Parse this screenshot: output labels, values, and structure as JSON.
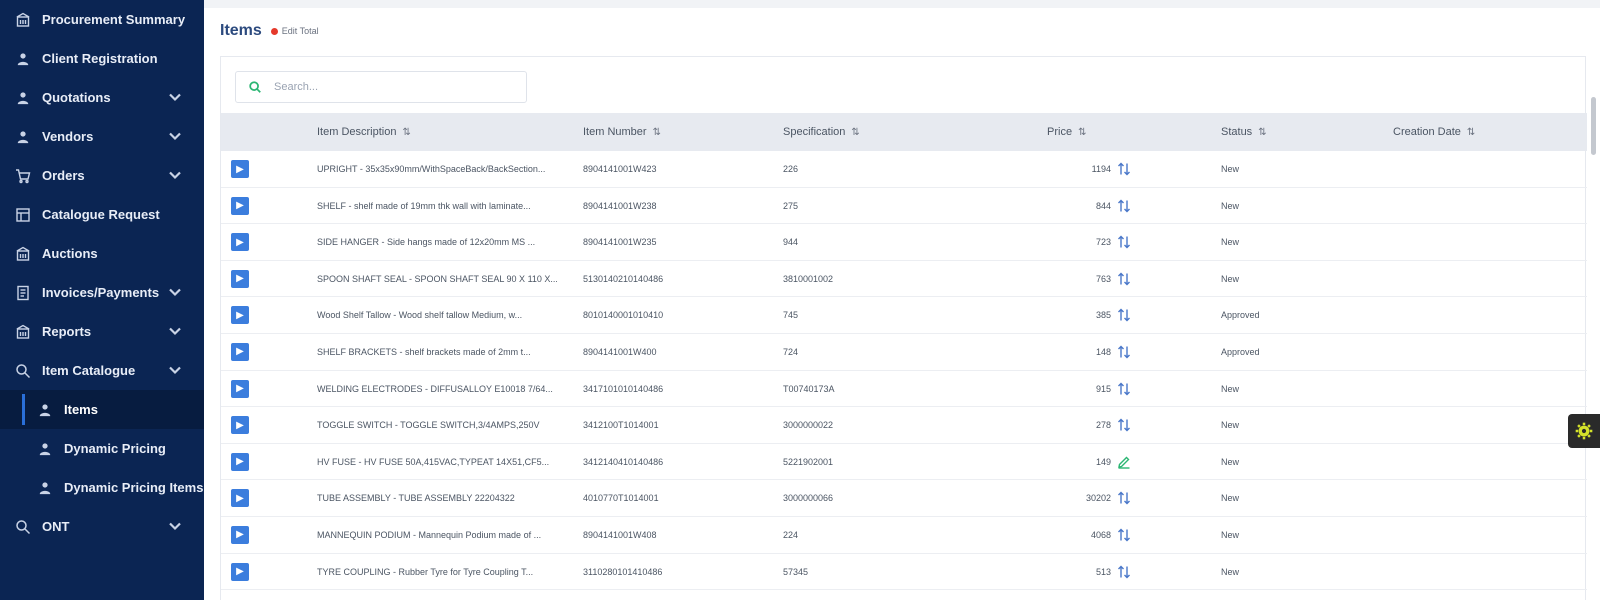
{
  "sidebar": {
    "items": [
      {
        "label": "Procurement Summary",
        "icon": "building-icon",
        "expandable": false
      },
      {
        "label": "Client Registration",
        "icon": "user-icon",
        "expandable": false
      },
      {
        "label": "Quotations",
        "icon": "user-icon",
        "expandable": true
      },
      {
        "label": "Vendors",
        "icon": "user-icon",
        "expandable": true
      },
      {
        "label": "Orders",
        "icon": "cart-icon",
        "expandable": true
      },
      {
        "label": "Catalogue Request",
        "icon": "catalogue-icon",
        "expandable": false
      },
      {
        "label": "Auctions",
        "icon": "building-icon",
        "expandable": false
      },
      {
        "label": "Invoices/Payments",
        "icon": "invoice-icon",
        "expandable": true
      },
      {
        "label": "Reports",
        "icon": "building-icon",
        "expandable": true
      },
      {
        "label": "Item Catalogue",
        "icon": "search-doc-icon",
        "expandable": true
      },
      {
        "label": "Items",
        "icon": "user-icon",
        "sub": true,
        "active": true
      },
      {
        "label": "Dynamic Pricing",
        "icon": "user-icon",
        "sub": true
      },
      {
        "label": "Dynamic Pricing Items",
        "icon": "user-icon",
        "sub": true
      },
      {
        "label": "ONT",
        "icon": "search-doc-icon",
        "expandable": true
      }
    ]
  },
  "header": {
    "title": "Items",
    "edit_label": "Edit Total"
  },
  "search": {
    "placeholder": "Search..."
  },
  "table": {
    "columns": [
      "Item Description",
      "Item Number",
      "Specification",
      "Price",
      "Status",
      "Creation Date"
    ],
    "rows": [
      {
        "desc": "UPRIGHT - 35x35x90mm/WithSpaceBack/BackSection...",
        "number": "8904141001W423",
        "spec": "226",
        "price": "1194",
        "status": "New",
        "price_icon": "sort-icon"
      },
      {
        "desc": "SHELF - shelf made of 19mm thk wall with laminate...",
        "number": "8904141001W238",
        "spec": "275",
        "price": "844",
        "status": "New",
        "price_icon": "sort-icon"
      },
      {
        "desc": "SIDE HANGER - Side hangs made of 12x20mm MS ...",
        "number": "8904141001W235",
        "spec": "944",
        "price": "723",
        "status": "New",
        "price_icon": "sort-icon"
      },
      {
        "desc": "SPOON SHAFT SEAL - SPOON SHAFT SEAL 90 X 110 X...",
        "number": "5130140210140486",
        "spec": "3810001002",
        "price": "763",
        "status": "New",
        "price_icon": "sort-icon"
      },
      {
        "desc": "Wood Shelf Tallow - Wood shelf tallow Medium, w...",
        "number": "8010140001010410",
        "spec": "745",
        "price": "385",
        "status": "Approved",
        "price_icon": "sort-icon"
      },
      {
        "desc": "SHELF BRACKETS - shelf brackets made of 2mm t...",
        "number": "8904141001W400",
        "spec": "724",
        "price": "148",
        "status": "Approved",
        "price_icon": "sort-icon"
      },
      {
        "desc": "WELDING ELECTRODES - DIFFUSALLOY E10018 7/64...",
        "number": "3417101010140486",
        "spec": "T00740173A",
        "price": "915",
        "status": "New",
        "price_icon": "sort-icon"
      },
      {
        "desc": "TOGGLE SWITCH - TOGGLE SWITCH,3/4AMPS,250V",
        "number": "3412100T1014001",
        "spec": "3000000022",
        "price": "278",
        "status": "New",
        "price_icon": "sort-icon"
      },
      {
        "desc": "HV FUSE - HV FUSE 50A,415VAC,TYPEAT 14X51,CF5...",
        "number": "3412140410140486",
        "spec": "5221902001",
        "price": "149",
        "status": "New",
        "price_icon": "edit-icon"
      },
      {
        "desc": "TUBE ASSEMBLY - TUBE ASSEMBLY 22204322",
        "number": "4010770T1014001",
        "spec": "3000000066",
        "price": "30202",
        "status": "New",
        "price_icon": "sort-icon"
      },
      {
        "desc": "MANNEQUIN PODIUM - Mannequin Podium made of ...",
        "number": "8904141001W408",
        "spec": "224",
        "price": "4068",
        "status": "New",
        "price_icon": "sort-icon"
      },
      {
        "desc": "TYRE COUPLING - Rubber Tyre for Tyre Coupling T...",
        "number": "3110280101410486",
        "spec": "57345",
        "price": "513",
        "status": "New",
        "price_icon": "sort-icon"
      }
    ]
  }
}
